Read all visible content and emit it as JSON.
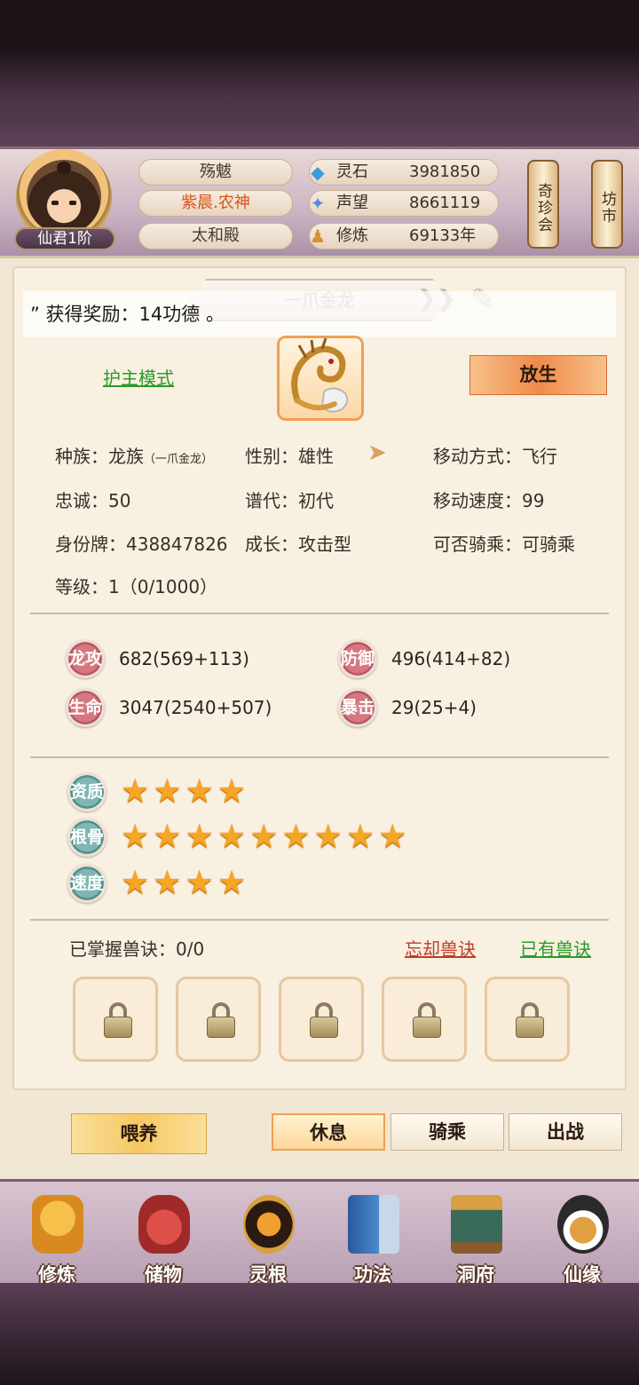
{
  "player": {
    "rank": "仙君1阶",
    "titles": [
      "殇魃",
      "紫晨.农神",
      "太和殿"
    ],
    "resources": [
      {
        "label": "灵石",
        "value": "3981850",
        "icon": "spirit-stone-icon"
      },
      {
        "label": "声望",
        "value": "8661119",
        "icon": "prestige-icon"
      },
      {
        "label": "修炼",
        "value": "69133年",
        "icon": "cultivation-icon"
      }
    ]
  },
  "side_buttons": {
    "treasure_fair": "奇珍会",
    "market": "坊市"
  },
  "pet": {
    "banner_title": "一爪金龙",
    "toast": "” 获得奖励：14功德 。",
    "guard_mode": "护主模式",
    "release": "放生",
    "species_label": "种族：",
    "species_value": "龙族",
    "species_sub": "（一爪金龙）",
    "gender": "性别：雄性",
    "move_type": "移动方式：飞行",
    "loyalty": "忠诚：50",
    "generation": "谱代：初代",
    "move_speed": "移动速度：99",
    "id_tag": "身份牌：438847826",
    "growth": "成长：攻击型",
    "rideable": "可否骑乘：可骑乘",
    "level": "等级：1（0/1000）"
  },
  "stats": [
    {
      "label": "龙攻",
      "value": "682(569+113)"
    },
    {
      "label": "防御",
      "value": "496(414+82)"
    },
    {
      "label": "生命",
      "value": "3047(2540+507)"
    },
    {
      "label": "暴击",
      "value": "29(25+4)"
    }
  ],
  "aptitudes": [
    {
      "label": "资质",
      "stars": 4,
      "text": "★★★★"
    },
    {
      "label": "根骨",
      "stars": 9,
      "text": "★★★★★★★★★"
    },
    {
      "label": "速度",
      "stars": 4,
      "text": "★★★★"
    }
  ],
  "skills": {
    "mastered": "已掌握兽诀：0/0",
    "forget": "忘却兽诀",
    "owned": "已有兽诀",
    "slots_locked": 5
  },
  "actions": {
    "feed": "喂养",
    "rest": "休息",
    "ride": "骑乘",
    "battle": "出战"
  },
  "nav": [
    "修炼",
    "储物",
    "灵根",
    "功法",
    "洞府",
    "仙缘"
  ]
}
